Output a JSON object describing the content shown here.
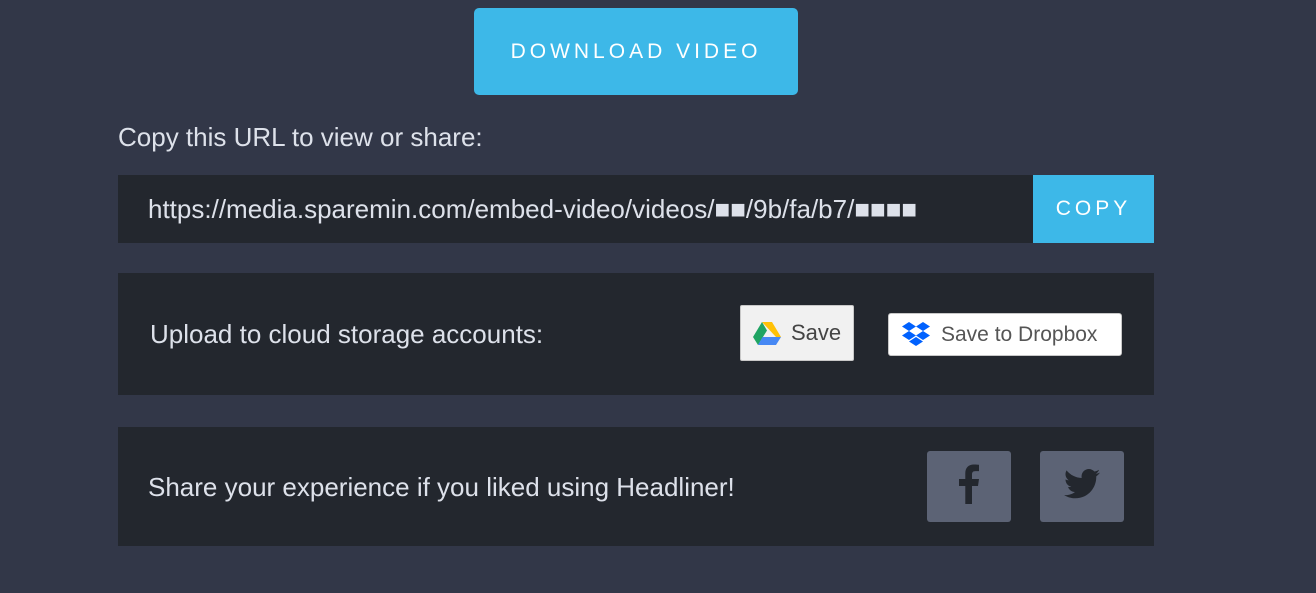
{
  "download": {
    "label": "DOWNLOAD VIDEO"
  },
  "share_url": {
    "heading": "Copy this URL to view or share:",
    "url": "https://media.sparemin.com/embed-video/videos/■■/9b/fa/b7/■■■■",
    "copy_label": "COPY"
  },
  "cloud_upload": {
    "heading": "Upload to cloud storage accounts:",
    "google_drive_label": "Save",
    "dropbox_label": "Save to Dropbox"
  },
  "social": {
    "heading": "Share your experience if you liked using Headliner!",
    "facebook_icon": "facebook-icon",
    "twitter_icon": "twitter-icon"
  },
  "colors": {
    "background": "#323748",
    "panel": "#23272e",
    "accent": "#3db8e8",
    "social_button": "#5c6375"
  }
}
